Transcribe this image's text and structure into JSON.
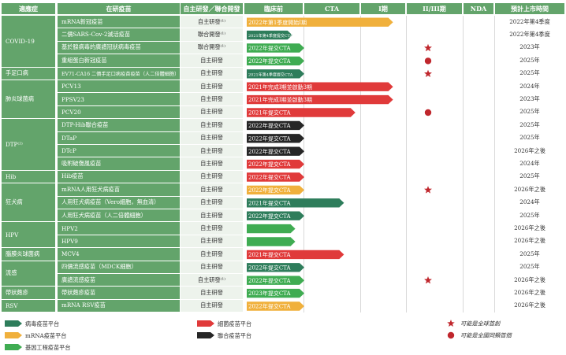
{
  "headers": {
    "indication": "適應症",
    "vaccine": "在研疫苗",
    "mode": "自主研發／聯合開發",
    "preclinical": "臨床前",
    "cta": "CTA",
    "phase1": "I期",
    "phase23": "II/III期",
    "nda": "NDA",
    "launch": "預計上市時間"
  },
  "indication_groups": [
    {
      "label": "COVID-19",
      "rows": 4
    },
    {
      "label": "手足口病",
      "rows": 1
    },
    {
      "label": "肺炎球菌病",
      "rows": 3
    },
    {
      "label": "DTP⁽²⁾",
      "rows": 4
    },
    {
      "label": "Hib",
      "rows": 1
    },
    {
      "label": "狂犬病",
      "rows": 3
    },
    {
      "label": "HPV",
      "rows": 2
    },
    {
      "label": "腦膜炎球菌病",
      "rows": 1
    },
    {
      "label": "流感",
      "rows": 2
    },
    {
      "label": "帶狀皰疹",
      "rows": 1
    },
    {
      "label": "RSV",
      "rows": 1
    }
  ],
  "colors": {
    "mrna": "#f0b03c",
    "viral_vector": "#2e7d5b",
    "bacterial": "#e03a3a",
    "combination": "#262626",
    "genetic_engineering": "#3fac52",
    "marker": "#c0272d",
    "header": "#63a46b"
  },
  "chart_data": {
    "type": "table",
    "stages": [
      "臨床前",
      "CTA",
      "I期",
      "II/III期",
      "NDA"
    ],
    "rows": [
      {
        "vaccine": "mRNA新冠疫苗",
        "mode": "自主研發⁽¹⁾",
        "platform": "mrna",
        "stage_end": 2.7,
        "bar_text": "2022年第1季度開始I期",
        "marker": "",
        "launch": "2022年第4季度"
      },
      {
        "vaccine": "二價SARS-Cov-2滅活疫苗",
        "mode": "聯合開發⁽¹⁾",
        "platform": "viral_vector",
        "stage_end": 0.8,
        "bar_text": "2021年第4季度提交CTA",
        "marker": "",
        "launch": "2022年第4季度"
      },
      {
        "vaccine": "基於腺病毒的廣譜冠狀病毒疫苗",
        "mode": "聯合開發⁽¹⁾",
        "platform": "genetic_engineering",
        "stage_end": 1.0,
        "bar_text": "2022年提交CTA",
        "marker": "star",
        "launch": "2023年"
      },
      {
        "vaccine": "重組蛋白新冠疫苗",
        "mode": "自主研發",
        "platform": "genetic_engineering",
        "stage_end": 1.0,
        "bar_text": "2022年提交CTA",
        "marker": "circle",
        "launch": "2025年"
      },
      {
        "vaccine": "EV71-CA16 二價手足口病疫苗疫苗（人二倍體細胞）",
        "mode": "自主研發",
        "platform": "viral_vector",
        "stage_end": 1.0,
        "bar_text": "2021年第4季度提交CTA",
        "marker": "star",
        "launch": "2025年"
      },
      {
        "vaccine": "PCV13",
        "mode": "自主研發",
        "platform": "bacterial",
        "stage_end": 2.7,
        "bar_text": "2021年完成I期並啟動3期",
        "marker": "",
        "launch": "2024年"
      },
      {
        "vaccine": "PPSV23",
        "mode": "自主研發",
        "platform": "bacterial",
        "stage_end": 2.7,
        "bar_text": "2021年完成I期並啟動3期",
        "marker": "",
        "launch": "2023年"
      },
      {
        "vaccine": "PCV20",
        "mode": "自主研發",
        "platform": "bacterial",
        "stage_end": 1.9,
        "bar_text": "2021年提交CTA",
        "marker": "circle",
        "launch": "2025年"
      },
      {
        "vaccine": "DTP-Hib聯合疫苗",
        "mode": "自主研發",
        "platform": "combination",
        "stage_end": 1.0,
        "bar_text": "2022年提交CTA",
        "marker": "",
        "launch": "2025年"
      },
      {
        "vaccine": "DTaP",
        "mode": "自主研發",
        "platform": "combination",
        "stage_end": 1.0,
        "bar_text": "2022年提交CTA",
        "marker": "",
        "launch": "2025年"
      },
      {
        "vaccine": "DTcP",
        "mode": "自主研發",
        "platform": "combination",
        "stage_end": 1.0,
        "bar_text": "2022年提交CTA",
        "marker": "",
        "launch": "2026年之後"
      },
      {
        "vaccine": "吸附破傷風疫苗",
        "mode": "自主研發",
        "platform": "bacterial",
        "stage_end": 1.0,
        "bar_text": "2022年提交CTA",
        "marker": "",
        "launch": "2024年"
      },
      {
        "vaccine": "Hib疫苗",
        "mode": "自主研發",
        "platform": "bacterial",
        "stage_end": 1.0,
        "bar_text": "2022年提交CTA",
        "marker": "",
        "launch": "2025年"
      },
      {
        "vaccine": "mRNA人用狂犬病疫苗",
        "mode": "自主研發",
        "platform": "mrna",
        "stage_end": 1.0,
        "bar_text": "2022年提交CTA",
        "marker": "star",
        "launch": "2026年之後"
      },
      {
        "vaccine": "人用狂犬病疫苗（Vero細胞，無血清）",
        "mode": "自主研發",
        "platform": "viral_vector",
        "stage_end": 1.7,
        "bar_text": "2021年提交CTA",
        "marker": "",
        "launch": "2024年"
      },
      {
        "vaccine": "人用狂犬病疫苗（人二倍體細胞）",
        "mode": "自主研發",
        "platform": "viral_vector",
        "stage_end": 1.0,
        "bar_text": "2022年提交CTA",
        "marker": "",
        "launch": "2025年"
      },
      {
        "vaccine": "HPV2",
        "mode": "自主研發",
        "platform": "genetic_engineering",
        "stage_end": 0.85,
        "bar_text": "",
        "marker": "",
        "launch": "2026年之後"
      },
      {
        "vaccine": "HPV9",
        "mode": "自主研發",
        "platform": "genetic_engineering",
        "stage_end": 0.85,
        "bar_text": "",
        "marker": "",
        "launch": "2026年之後"
      },
      {
        "vaccine": "MCV4",
        "mode": "自主研發",
        "platform": "bacterial",
        "stage_end": 1.7,
        "bar_text": "2021年提交CTA",
        "marker": "",
        "launch": "2025年"
      },
      {
        "vaccine": "四價流感疫苗（MDCK細胞）",
        "mode": "自主研發",
        "platform": "viral_vector",
        "stage_end": 1.0,
        "bar_text": "2022年提交CTA",
        "marker": "",
        "launch": "2025年"
      },
      {
        "vaccine": "廣譜流感疫苗",
        "mode": "自主研發⁽¹⁾",
        "platform": "genetic_engineering",
        "stage_end": 1.0,
        "bar_text": "2022年提交CTA",
        "marker": "star",
        "launch": "2026年之後"
      },
      {
        "vaccine": "帶狀皰疹疫苗",
        "mode": "自主研發",
        "platform": "genetic_engineering",
        "stage_end": 1.0,
        "bar_text": "2023年提交CTA",
        "marker": "",
        "launch": "2026年之後"
      },
      {
        "vaccine": "mRNA RSV疫苗",
        "mode": "自主研發",
        "platform": "mrna",
        "stage_end": 1.0,
        "bar_text": "2022年提交CTA",
        "marker": "",
        "launch": "2026年之後"
      }
    ],
    "legend": [
      {
        "key": "viral_vector",
        "label": "病毒疫苗平台"
      },
      {
        "key": "mrna",
        "label": "mRNA疫苗平台"
      },
      {
        "key": "genetic_engineering",
        "label": "基因工程疫苗平台"
      },
      {
        "key": "bacterial",
        "label": "細菌疫苗平台"
      },
      {
        "key": "combination",
        "label": "聯合疫苗平台"
      }
    ],
    "marker_legend": [
      {
        "key": "star",
        "label": "可能是全球首創"
      },
      {
        "key": "circle",
        "label": "可能是全國同類首個"
      }
    ]
  }
}
